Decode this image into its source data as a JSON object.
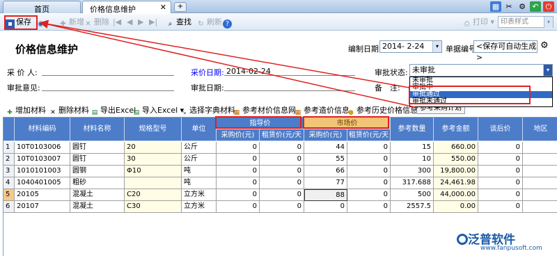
{
  "tabs": {
    "home": "首页",
    "active": "价格信息维护"
  },
  "toolbar": {
    "save": "保存",
    "new": "新增",
    "delete": "删除",
    "find": "查找",
    "refresh": "刷新",
    "print": "打印",
    "print_style": "印表样式"
  },
  "header": {
    "title": "价格信息维护",
    "compile_date_label": "编制日期",
    "compile_date": "2014- 2-24",
    "doc_no_label": "单据编号",
    "doc_no": "<保存可自动生成>",
    "buyer_label": "采 价 人:",
    "price_date_label": "采价日期:",
    "price_date": "2014-02-24",
    "approval_status_label": "审批状态:",
    "approval_status": "未审批",
    "approval_opinion_label": "审批意见:",
    "approval_date_label": "审批日期:",
    "remark_label": "备　注:",
    "status_options": [
      "未审批",
      "审批中",
      "审批通过",
      "审批未通过"
    ]
  },
  "material_toolbar": {
    "add": "增加材料",
    "del": "删除材料",
    "export": "导出Excel",
    "import": "导入Excel",
    "dict": "选择字典材料",
    "ref_net": "参考材价信息网",
    "ref_cost": "参考造价信息",
    "ref_hist": "参考历史价格信息",
    "ref_plan": "参考采购计划"
  },
  "grid": {
    "columns": [
      "材料编码",
      "材料名称",
      "规格型号",
      "单位",
      "参考数量",
      "参考金额",
      "谈后价",
      "地区"
    ],
    "group_guide": "指导价",
    "group_market": "市场价",
    "sub_purchase": "采购价(元)",
    "sub_lease": "租赁价(元/天",
    "rows": [
      {
        "n": "1",
        "code": "10T0103006",
        "name": "圆钉",
        "spec": "20",
        "unit": "公斤",
        "g1": "0",
        "g2": "0",
        "m1": "44",
        "m2": "0",
        "qty": "15",
        "amt": "660.00",
        "after": "0"
      },
      {
        "n": "2",
        "code": "10T0103007",
        "name": "圆钉",
        "spec": "30",
        "unit": "公斤",
        "g1": "0",
        "g2": "0",
        "m1": "55",
        "m2": "0",
        "qty": "10",
        "amt": "550.00",
        "after": "0"
      },
      {
        "n": "3",
        "code": "1010101003",
        "name": "圆钢",
        "spec": "Φ10",
        "unit": "吨",
        "g1": "0",
        "g2": "0",
        "m1": "66",
        "m2": "0",
        "qty": "300",
        "amt": "19,800.00",
        "after": "0"
      },
      {
        "n": "4",
        "code": "1040401005",
        "name": "粗砂",
        "spec": "",
        "unit": "吨",
        "g1": "0",
        "g2": "0",
        "m1": "77",
        "m2": "0",
        "qty": "317.688",
        "amt": "24,461.98",
        "after": "0"
      },
      {
        "n": "5",
        "code": "20105",
        "name": "混凝土",
        "spec": "C20",
        "unit": "立方米",
        "g1": "0",
        "g2": "0",
        "m1": "88",
        "m2": "0",
        "qty": "500",
        "amt": "44,000.00",
        "after": "0"
      },
      {
        "n": "6",
        "code": "20107",
        "name": "混凝土",
        "spec": "C30",
        "unit": "立方米",
        "g1": "0",
        "g2": "0",
        "m1": "0",
        "m2": "0",
        "qty": "2557.5",
        "amt": "0.00",
        "after": "0"
      }
    ]
  },
  "watermark": {
    "brand": "泛普软件",
    "url": "www.fanpusoft.com"
  }
}
